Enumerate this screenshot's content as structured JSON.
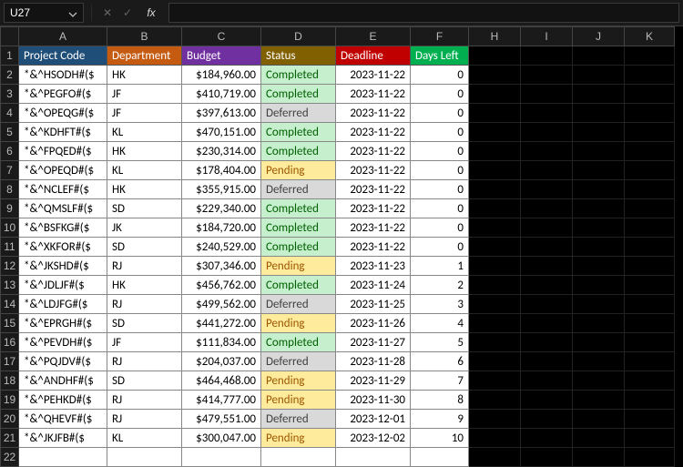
{
  "cellref": "U27",
  "formula": "",
  "cols": [
    "A",
    "B",
    "C",
    "D",
    "E",
    "F",
    "H",
    "I",
    "J",
    "K"
  ],
  "widths": {
    "row": 20,
    "A": 97,
    "B": 82,
    "C": 87,
    "D": 82,
    "E": 82,
    "F": 64,
    "H": 57,
    "I": 57,
    "J": 57,
    "K": 55
  },
  "headers": {
    "A": "Project Code",
    "B": "Department",
    "C": "Budget",
    "D": "Status",
    "E": "Deadline",
    "F": "Days Left"
  },
  "rows": [
    {
      "n": 2,
      "A": "*&^HSODH#($",
      "B": "HK",
      "C": "$184,960.00",
      "D": "Completed",
      "E": "2023-11-22",
      "F": "0"
    },
    {
      "n": 3,
      "A": "*&^PEGFO#($",
      "B": "JF",
      "C": "$410,719.00",
      "D": "Completed",
      "E": "2023-11-22",
      "F": "0"
    },
    {
      "n": 4,
      "A": "*&^OPEQG#($",
      "B": "JF",
      "C": "$397,613.00",
      "D": "Deferred",
      "E": "2023-11-22",
      "F": "0"
    },
    {
      "n": 5,
      "A": "*&^KDHFT#($",
      "B": "KL",
      "C": "$470,151.00",
      "D": "Completed",
      "E": "2023-11-22",
      "F": "0"
    },
    {
      "n": 6,
      "A": "*&^FPQED#($",
      "B": "HK",
      "C": "$230,314.00",
      "D": "Completed",
      "E": "2023-11-22",
      "F": "0"
    },
    {
      "n": 7,
      "A": "*&^OPEQD#($",
      "B": "KL",
      "C": "$178,404.00",
      "D": "Pending",
      "E": "2023-11-22",
      "F": "0"
    },
    {
      "n": 8,
      "A": "*&^NCLEF#($",
      "B": "HK",
      "C": "$355,915.00",
      "D": "Deferred",
      "E": "2023-11-22",
      "F": "0"
    },
    {
      "n": 9,
      "A": "*&^QMSLF#($",
      "B": "SD",
      "C": "$229,340.00",
      "D": "Completed",
      "E": "2023-11-22",
      "F": "0"
    },
    {
      "n": 10,
      "A": "*&^BSFKG#($",
      "B": "JK",
      "C": "$184,720.00",
      "D": "Completed",
      "E": "2023-11-22",
      "F": "0"
    },
    {
      "n": 11,
      "A": "*&^XKFOR#($",
      "B": "SD",
      "C": "$240,529.00",
      "D": "Completed",
      "E": "2023-11-22",
      "F": "0"
    },
    {
      "n": 12,
      "A": "*&^JKSHD#($",
      "B": "RJ",
      "C": "$307,346.00",
      "D": "Pending",
      "E": "2023-11-23",
      "F": "1"
    },
    {
      "n": 13,
      "A": "*&^JDLJF#($",
      "B": "HK",
      "C": "$456,762.00",
      "D": "Completed",
      "E": "2023-11-24",
      "F": "2"
    },
    {
      "n": 14,
      "A": "*&^LDJFG#($",
      "B": "RJ",
      "C": "$499,562.00",
      "D": "Deferred",
      "E": "2023-11-25",
      "F": "3"
    },
    {
      "n": 15,
      "A": "*&^EPRGH#($",
      "B": "SD",
      "C": "$441,272.00",
      "D": "Pending",
      "E": "2023-11-26",
      "F": "4"
    },
    {
      "n": 16,
      "A": "*&^PEVDH#($",
      "B": "JF",
      "C": "$111,834.00",
      "D": "Completed",
      "E": "2023-11-27",
      "F": "5"
    },
    {
      "n": 17,
      "A": "*&^PQJDV#($",
      "B": "RJ",
      "C": "$204,037.00",
      "D": "Deferred",
      "E": "2023-11-28",
      "F": "6"
    },
    {
      "n": 18,
      "A": "*&^ANDHF#($",
      "B": "SD",
      "C": "$464,468.00",
      "D": "Pending",
      "E": "2023-11-29",
      "F": "7"
    },
    {
      "n": 19,
      "A": "*&^PEHKD#($",
      "B": "RJ",
      "C": "$414,777.00",
      "D": "Pending",
      "E": "2023-11-30",
      "F": "8"
    },
    {
      "n": 20,
      "A": "*&^QHEVF#($",
      "B": "RJ",
      "C": "$479,551.00",
      "D": "Deferred",
      "E": "2023-12-01",
      "F": "9"
    },
    {
      "n": 21,
      "A": "*&^JKJFB#($",
      "B": "KL",
      "C": "$300,047.00",
      "D": "Pending",
      "E": "2023-12-02",
      "F": "10"
    }
  ],
  "lastRow": 22
}
